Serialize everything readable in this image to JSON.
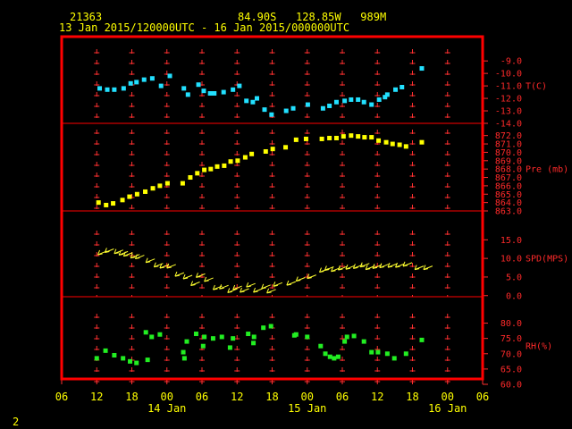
{
  "header": {
    "station_id": "21363",
    "location": "84.90S   128.85W   989M",
    "time_range": "13 Jan 2015/120000UTC - 16 Jan 2015/000000UTC"
  },
  "footer": {
    "page_number": "2"
  },
  "colors": {
    "background": "#000000",
    "frame": "#ff0000",
    "grid": "#ff3030",
    "axis_text_right": "#ff2a2a",
    "axis_text_bottom": "#ffff00",
    "temperature": "#22e0ff",
    "pressure": "#ffff00",
    "wind": "#ffff30",
    "humidity": "#22ee22"
  },
  "chart_data": {
    "type": "scatter",
    "x_axis": {
      "unit": "hours since 13 Jan 2015 06UTC",
      "range": [
        0,
        72
      ],
      "tick_labels": [
        "06",
        "12",
        "18",
        "00",
        "06",
        "12",
        "18",
        "00",
        "06",
        "12",
        "18",
        "00",
        "06"
      ],
      "day_labels": [
        {
          "label": "14 Jan",
          "hour": 18
        },
        {
          "label": "15 Jan",
          "hour": 42
        },
        {
          "label": "16 Jan",
          "hour": 66
        }
      ]
    },
    "panels": [
      {
        "id": "temperature",
        "label": "T(C)",
        "ylim": [
          -14,
          -8.2
        ],
        "ticks": [
          "-9.0",
          "-10.0",
          "-11.0",
          "-12.0",
          "-13.0",
          "-14.0"
        ],
        "tick_values": [
          -9,
          -10,
          -11,
          -12,
          -13,
          -14
        ],
        "marker": "square",
        "points": [
          [
            6.5,
            -11.2
          ],
          [
            7.8,
            -11.3
          ],
          [
            9.0,
            -11.3
          ],
          [
            10.6,
            -11.2
          ],
          [
            11.8,
            -10.8
          ],
          [
            12.8,
            -10.7
          ],
          [
            14.1,
            -10.5
          ],
          [
            15.5,
            -10.4
          ],
          [
            17.0,
            -11.0
          ],
          [
            18.5,
            -10.2
          ],
          [
            20.9,
            -11.2
          ],
          [
            21.6,
            -11.7
          ],
          [
            23.4,
            -10.9
          ],
          [
            24.3,
            -11.4
          ],
          [
            25.4,
            -11.6
          ],
          [
            26.1,
            -11.6
          ],
          [
            27.7,
            -11.5
          ],
          [
            29.3,
            -11.3
          ],
          [
            30.4,
            -11.0
          ],
          [
            31.6,
            -12.2
          ],
          [
            32.7,
            -12.3
          ],
          [
            33.4,
            -12.0
          ],
          [
            34.7,
            -12.9
          ],
          [
            35.9,
            -13.3
          ],
          [
            38.4,
            -13.0
          ],
          [
            39.6,
            -12.8
          ],
          [
            42.1,
            -12.5
          ],
          [
            44.7,
            -12.8
          ],
          [
            45.8,
            -12.6
          ],
          [
            47.0,
            -12.3
          ],
          [
            48.4,
            -12.2
          ],
          [
            49.5,
            -12.1
          ],
          [
            50.7,
            -12.1
          ],
          [
            51.7,
            -12.3
          ],
          [
            53.0,
            -12.5
          ],
          [
            54.3,
            -12.1
          ],
          [
            55.3,
            -11.9
          ],
          [
            55.7,
            -11.7
          ],
          [
            57.1,
            -11.3
          ],
          [
            58.2,
            -11.1
          ],
          [
            61.6,
            -9.6
          ]
        ]
      },
      {
        "id": "pressure",
        "label": "Pre (mb)",
        "ylim": [
          863,
          872.5
        ],
        "ticks": [
          "872.0",
          "871.0",
          "870.0",
          "869.0",
          "868.0",
          "867.0",
          "866.0",
          "865.0",
          "864.0",
          "863.0"
        ],
        "tick_values": [
          872,
          871,
          870,
          869,
          868,
          867,
          866,
          865,
          864,
          863
        ],
        "marker": "square",
        "points": [
          [
            6.3,
            864.0
          ],
          [
            7.6,
            863.7
          ],
          [
            8.8,
            863.9
          ],
          [
            10.4,
            864.3
          ],
          [
            11.6,
            864.7
          ],
          [
            12.9,
            865.0
          ],
          [
            14.3,
            865.3
          ],
          [
            15.6,
            865.7
          ],
          [
            16.8,
            866.0
          ],
          [
            18.1,
            866.3
          ],
          [
            20.7,
            866.3
          ],
          [
            22.0,
            867.0
          ],
          [
            23.2,
            867.5
          ],
          [
            24.4,
            867.9
          ],
          [
            25.5,
            868.0
          ],
          [
            26.6,
            868.3
          ],
          [
            27.8,
            868.4
          ],
          [
            28.9,
            868.9
          ],
          [
            30.1,
            869.0
          ],
          [
            31.4,
            869.4
          ],
          [
            32.5,
            869.8
          ],
          [
            34.9,
            870.1
          ],
          [
            36.1,
            870.4
          ],
          [
            38.3,
            870.6
          ],
          [
            40.1,
            871.5
          ],
          [
            41.8,
            871.6
          ],
          [
            44.5,
            871.6
          ],
          [
            45.8,
            871.7
          ],
          [
            47.0,
            871.7
          ],
          [
            48.2,
            871.9
          ],
          [
            49.5,
            872.0
          ],
          [
            50.7,
            871.9
          ],
          [
            51.8,
            871.8
          ],
          [
            53.0,
            871.8
          ],
          [
            54.2,
            871.4
          ],
          [
            55.5,
            871.2
          ],
          [
            56.6,
            871.0
          ],
          [
            57.8,
            870.9
          ],
          [
            58.9,
            870.7
          ],
          [
            61.6,
            871.2
          ]
        ]
      },
      {
        "id": "wind",
        "label": "SPD(MPS)",
        "ylim": [
          -0.3,
          17
        ],
        "ticks": [
          "15.0",
          "10.0",
          "5.0",
          "0.0"
        ],
        "tick_values": [
          15,
          10,
          5,
          0
        ],
        "marker": "wind-arrow",
        "points": [
          [
            6.2,
            11.0
          ],
          [
            7.4,
            11.6
          ],
          [
            9.0,
            11.3
          ],
          [
            9.8,
            10.9
          ],
          [
            10.6,
            10.6
          ],
          [
            11.8,
            10.1
          ],
          [
            12.6,
            9.9
          ],
          [
            14.4,
            8.9
          ],
          [
            15.8,
            7.7
          ],
          [
            16.8,
            7.4
          ],
          [
            18.0,
            7.4
          ],
          [
            19.4,
            5.2
          ],
          [
            20.8,
            4.5
          ],
          [
            22.1,
            2.7
          ],
          [
            23.0,
            4.9
          ],
          [
            24.4,
            3.8
          ],
          [
            25.9,
            1.6
          ],
          [
            27.0,
            1.8
          ],
          [
            28.4,
            0.8
          ],
          [
            29.3,
            1.6
          ],
          [
            30.5,
            0.9
          ],
          [
            31.6,
            2.3
          ],
          [
            32.8,
            0.9
          ],
          [
            34.2,
            1.9
          ],
          [
            35.1,
            0.7
          ],
          [
            36.2,
            2.5
          ],
          [
            38.5,
            2.8
          ],
          [
            40.1,
            3.9
          ],
          [
            42.0,
            4.6
          ],
          [
            44.1,
            6.3
          ],
          [
            45.0,
            6.8
          ],
          [
            46.1,
            6.5
          ],
          [
            47.3,
            6.9
          ],
          [
            48.6,
            7.1
          ],
          [
            49.9,
            7.3
          ],
          [
            51.1,
            7.7
          ],
          [
            52.0,
            7.0
          ],
          [
            53.2,
            7.3
          ],
          [
            54.4,
            7.5
          ],
          [
            55.8,
            7.6
          ],
          [
            57.1,
            7.6
          ],
          [
            58.4,
            7.9
          ],
          [
            60.4,
            7.0
          ],
          [
            61.9,
            7.0
          ]
        ]
      },
      {
        "id": "humidity",
        "label": "RH(%)",
        "ylim": [
          60,
          82.5
        ],
        "ticks": [
          "80.0",
          "75.0",
          "70.0",
          "65.0",
          "60.0"
        ],
        "tick_values": [
          80,
          75,
          70,
          65,
          60
        ],
        "marker": "square",
        "points": [
          [
            6.0,
            68.5
          ],
          [
            7.5,
            71.0
          ],
          [
            9.0,
            69.5
          ],
          [
            10.5,
            68.5
          ],
          [
            11.7,
            67.5
          ],
          [
            12.8,
            67.0
          ],
          [
            14.4,
            77.0
          ],
          [
            14.7,
            68.0
          ],
          [
            15.4,
            75.5
          ],
          [
            16.8,
            76.3
          ],
          [
            20.8,
            70.5
          ],
          [
            21.0,
            68.5
          ],
          [
            21.4,
            74.0
          ],
          [
            23.0,
            76.5
          ],
          [
            24.2,
            72.5
          ],
          [
            24.4,
            75.5
          ],
          [
            25.9,
            75.0
          ],
          [
            27.4,
            75.5
          ],
          [
            28.8,
            72.0
          ],
          [
            29.3,
            75.0
          ],
          [
            31.9,
            76.5
          ],
          [
            32.8,
            73.5
          ],
          [
            32.9,
            75.5
          ],
          [
            34.5,
            78.5
          ],
          [
            35.8,
            79.0
          ],
          [
            39.8,
            76.0
          ],
          [
            40.1,
            76.3
          ],
          [
            42.0,
            75.5
          ],
          [
            44.3,
            72.5
          ],
          [
            45.1,
            70.0
          ],
          [
            45.9,
            69.0
          ],
          [
            46.6,
            68.5
          ],
          [
            47.3,
            69.0
          ],
          [
            48.4,
            74.0
          ],
          [
            48.8,
            75.5
          ],
          [
            50.0,
            75.8
          ],
          [
            51.7,
            74.0
          ],
          [
            53.0,
            70.5
          ],
          [
            54.1,
            70.5
          ],
          [
            55.7,
            70.0
          ],
          [
            56.9,
            68.5
          ],
          [
            58.9,
            70.0
          ],
          [
            61.6,
            74.5
          ]
        ]
      }
    ]
  }
}
